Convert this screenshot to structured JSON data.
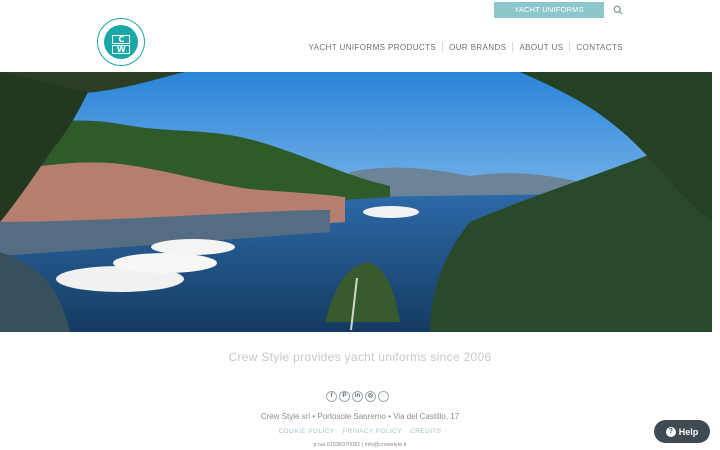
{
  "header": {
    "catalogue_button": "YACHT UNIFORMS CATALOGUE",
    "search_icon": "search-icon",
    "nav": [
      "YACHT UNIFORMS PRODUCTS",
      "OUR BRANDS",
      "ABOUT US",
      "CONTACTS"
    ],
    "logo_icon": "crew-style-logo",
    "accent_color": "#1aa7a7"
  },
  "hero": {
    "description_icon": "panoramic-harbor-image"
  },
  "main": {
    "tagline": "Crew Style provides yacht uniforms since 2006"
  },
  "footer": {
    "social": [
      "f",
      "P",
      "in",
      "◎",
      "◌"
    ],
    "address": "Crew Style srl • Portosole Sanremo • Via del Castillo, 17",
    "links": [
      "COOKIE POLICY",
      "PRIVACY POLICY",
      "CREDITS"
    ],
    "meta": "p.iva 01536370081 | info@crewstyle.it"
  },
  "help": {
    "label": "Help"
  }
}
